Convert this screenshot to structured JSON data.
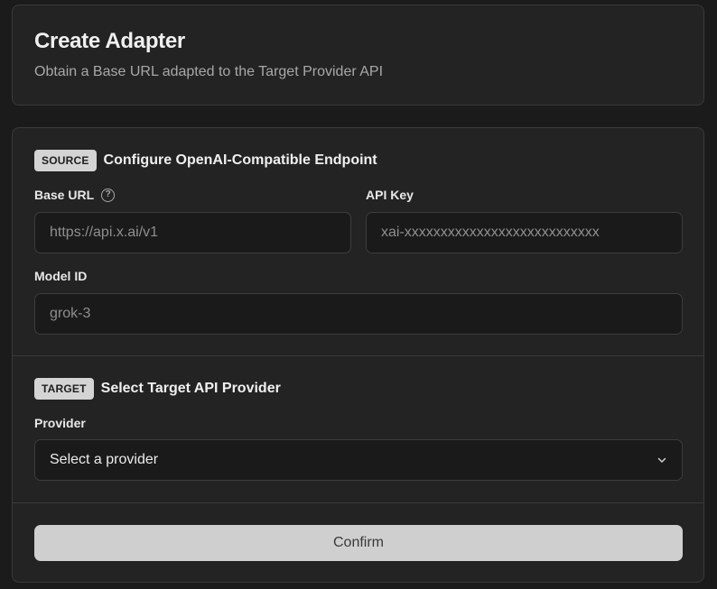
{
  "header": {
    "title": "Create Adapter",
    "subtitle": "Obtain a Base URL adapted to the Target Provider API"
  },
  "source": {
    "badge": "SOURCE",
    "title": "Configure OpenAI-Compatible Endpoint",
    "base_url": {
      "label": "Base URL",
      "help_icon": "question-circle-icon",
      "placeholder": "https://api.x.ai/v1",
      "value": ""
    },
    "api_key": {
      "label": "API Key",
      "placeholder": "xai-xxxxxxxxxxxxxxxxxxxxxxxxxxx",
      "value": ""
    },
    "model_id": {
      "label": "Model ID",
      "placeholder": "grok-3",
      "value": ""
    }
  },
  "target": {
    "badge": "TARGET",
    "title": "Select Target API Provider",
    "provider": {
      "label": "Provider",
      "selected": "Select a provider",
      "icon": "chevron-down-icon"
    }
  },
  "actions": {
    "confirm_label": "Confirm"
  },
  "colors": {
    "background": "#1b1b1b",
    "card": "#232323",
    "border": "#3a3a3a",
    "badge": "#d4d4d4",
    "button": "#cfcfcf"
  }
}
